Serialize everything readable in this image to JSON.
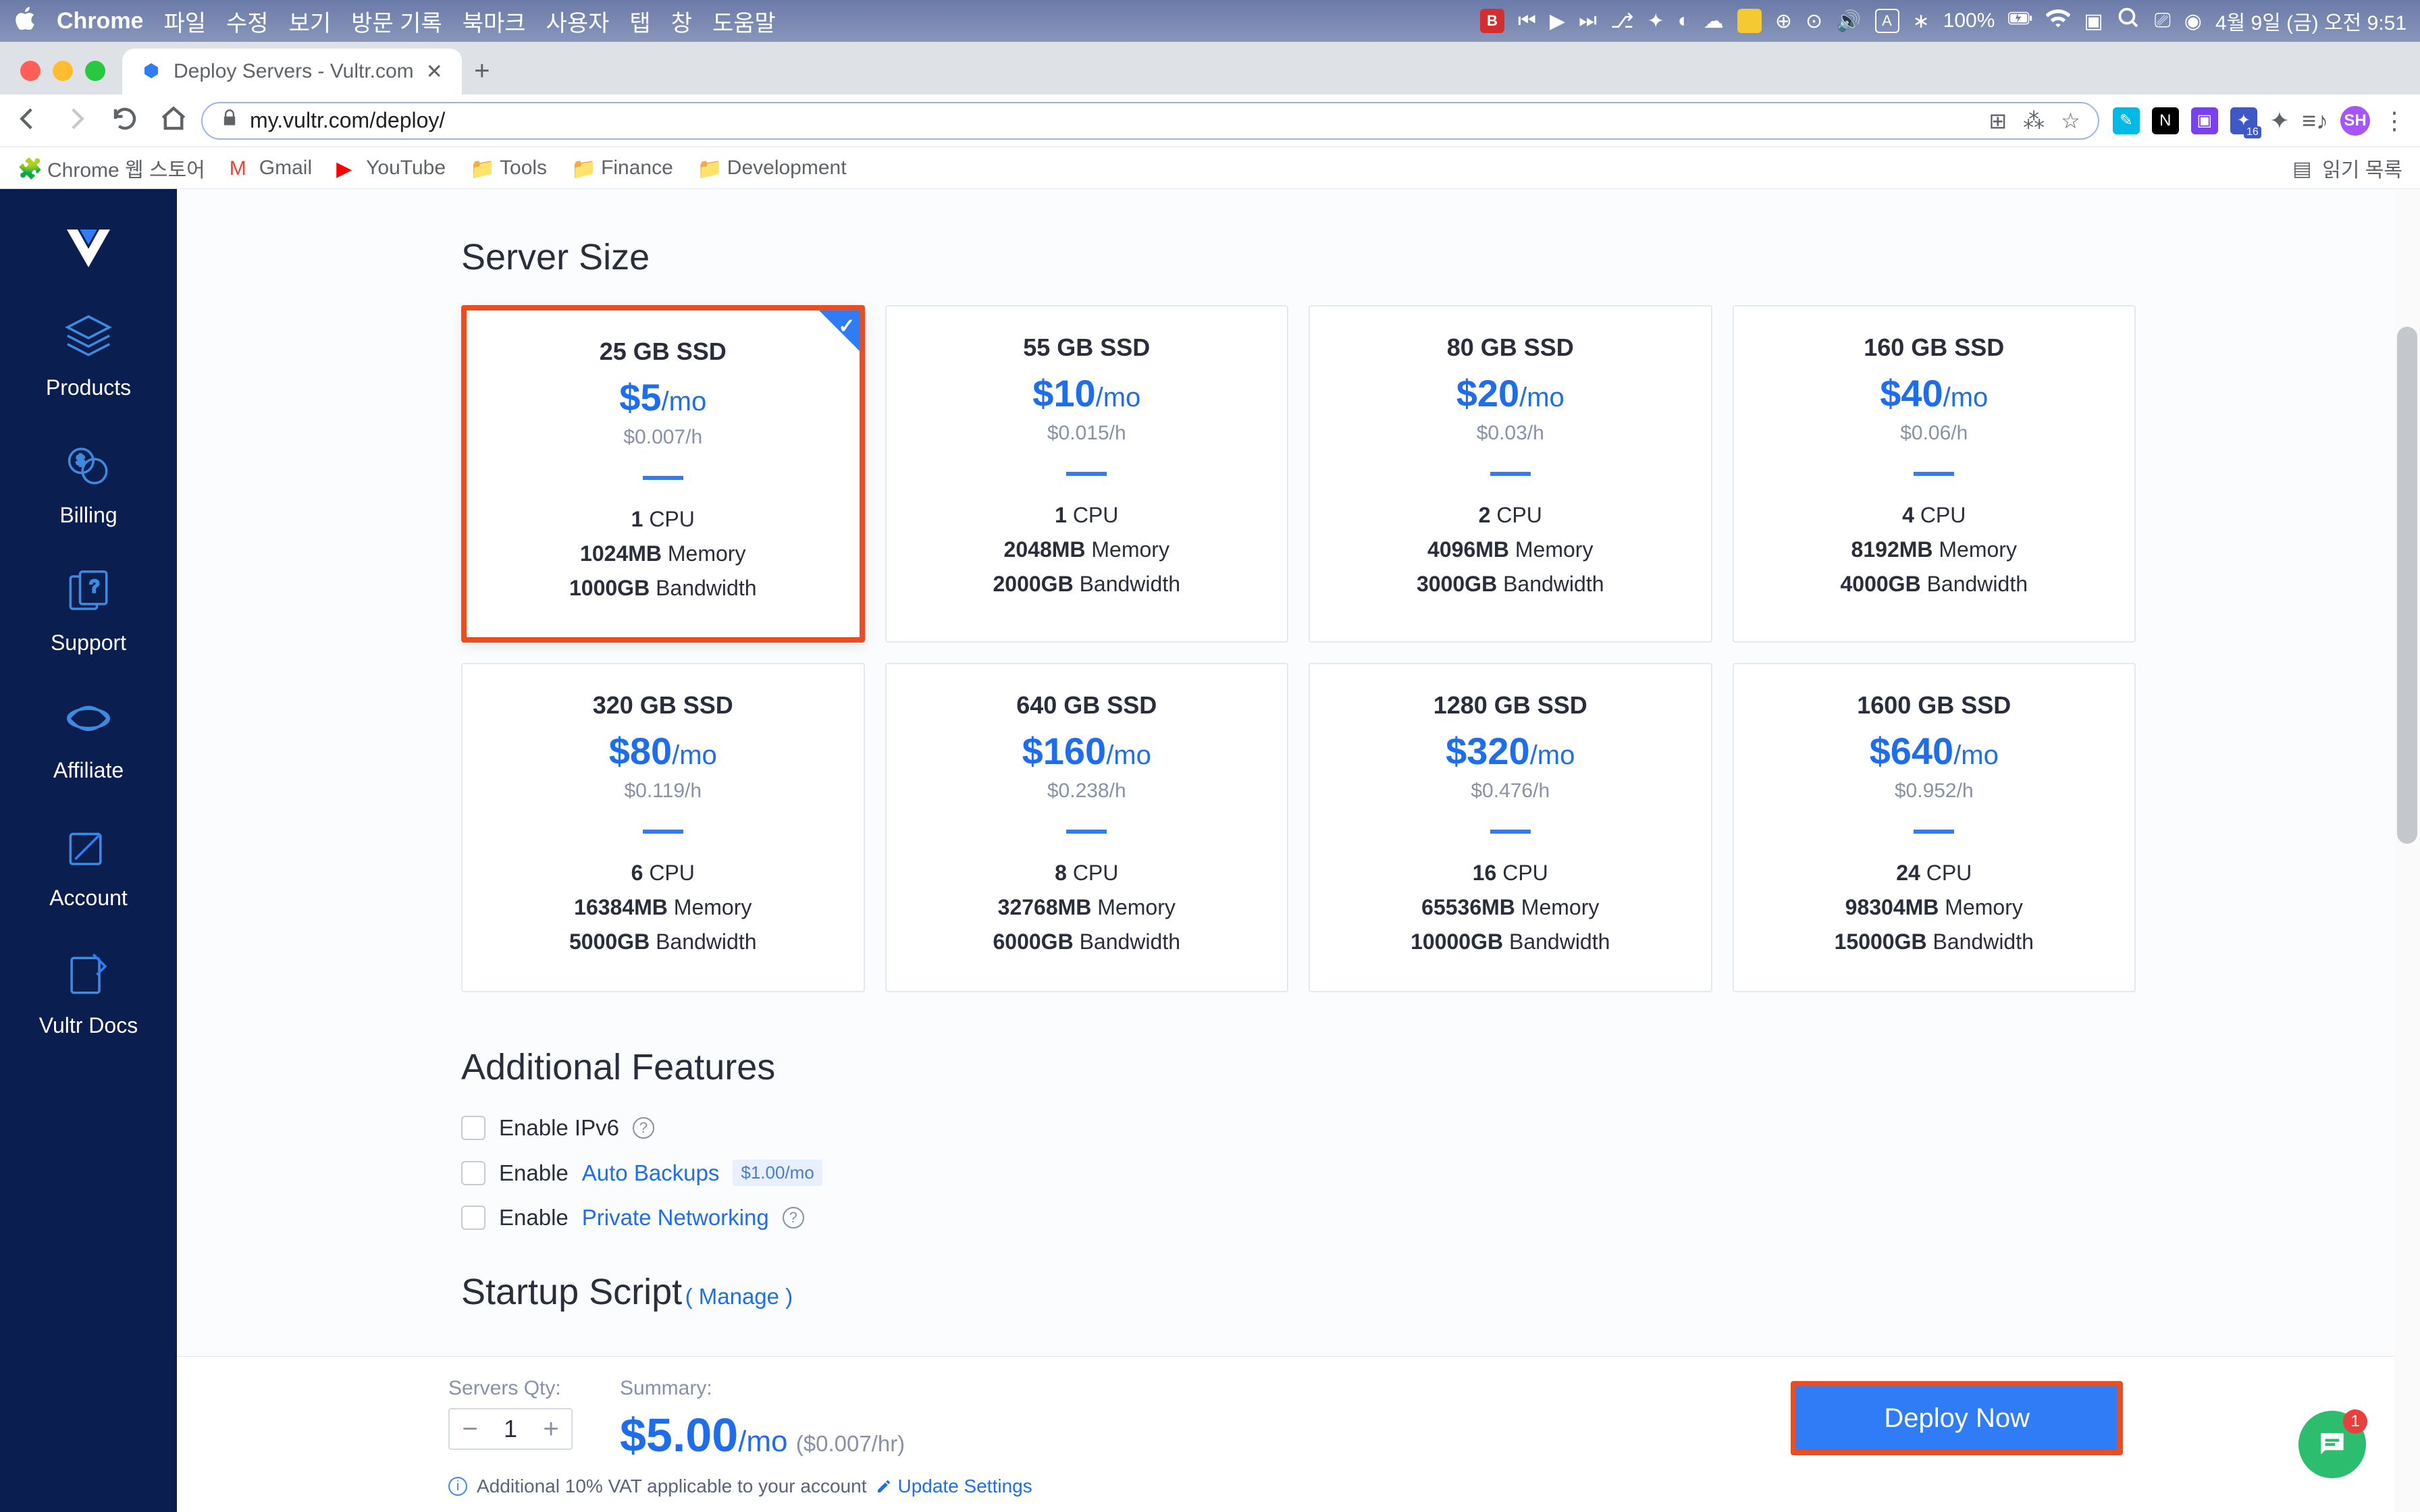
{
  "menubar": {
    "app": "Chrome",
    "items": [
      "파일",
      "수정",
      "보기",
      "방문 기록",
      "북마크",
      "사용자",
      "탭",
      "창",
      "도움말"
    ],
    "battery": "100%",
    "date": "4월 9일 (금) 오전 9:51"
  },
  "tab": {
    "title": "Deploy Servers - Vultr.com"
  },
  "url": "my.vultr.com/deploy/",
  "bookmarks": [
    "Chrome 웹 스토어",
    "Gmail",
    "YouTube",
    "Tools",
    "Finance",
    "Development"
  ],
  "reading_list": "읽기 목록",
  "sidebar": {
    "items": [
      {
        "label": "Products"
      },
      {
        "label": "Billing"
      },
      {
        "label": "Support"
      },
      {
        "label": "Affiliate"
      },
      {
        "label": "Account"
      },
      {
        "label": "Vultr Docs"
      }
    ]
  },
  "section_title": "Server Size",
  "plans": [
    {
      "ssd": "25 GB SSD",
      "price": "$5",
      "per": "/mo",
      "hourly": "$0.007/h",
      "cpu_n": "1",
      "cpu": " CPU",
      "mem_n": "1024MB",
      "mem": " Memory",
      "bw_n": "1000GB",
      "bw": " Bandwidth",
      "sel": true
    },
    {
      "ssd": "55 GB SSD",
      "price": "$10",
      "per": "/mo",
      "hourly": "$0.015/h",
      "cpu_n": "1",
      "cpu": " CPU",
      "mem_n": "2048MB",
      "mem": " Memory",
      "bw_n": "2000GB",
      "bw": " Bandwidth"
    },
    {
      "ssd": "80 GB SSD",
      "price": "$20",
      "per": "/mo",
      "hourly": "$0.03/h",
      "cpu_n": "2",
      "cpu": " CPU",
      "mem_n": "4096MB",
      "mem": " Memory",
      "bw_n": "3000GB",
      "bw": " Bandwidth"
    },
    {
      "ssd": "160 GB SSD",
      "price": "$40",
      "per": "/mo",
      "hourly": "$0.06/h",
      "cpu_n": "4",
      "cpu": " CPU",
      "mem_n": "8192MB",
      "mem": " Memory",
      "bw_n": "4000GB",
      "bw": " Bandwidth"
    },
    {
      "ssd": "320 GB SSD",
      "price": "$80",
      "per": "/mo",
      "hourly": "$0.119/h",
      "cpu_n": "6",
      "cpu": " CPU",
      "mem_n": "16384MB",
      "mem": " Memory",
      "bw_n": "5000GB",
      "bw": " Bandwidth"
    },
    {
      "ssd": "640 GB SSD",
      "price": "$160",
      "per": "/mo",
      "hourly": "$0.238/h",
      "cpu_n": "8",
      "cpu": " CPU",
      "mem_n": "32768MB",
      "mem": " Memory",
      "bw_n": "6000GB",
      "bw": " Bandwidth"
    },
    {
      "ssd": "1280 GB SSD",
      "price": "$320",
      "per": "/mo",
      "hourly": "$0.476/h",
      "cpu_n": "16",
      "cpu": " CPU",
      "mem_n": "65536MB",
      "mem": " Memory",
      "bw_n": "10000GB",
      "bw": " Bandwidth"
    },
    {
      "ssd": "1600 GB SSD",
      "price": "$640",
      "per": "/mo",
      "hourly": "$0.952/h",
      "cpu_n": "24",
      "cpu": " CPU",
      "mem_n": "98304MB",
      "mem": " Memory",
      "bw_n": "15000GB",
      "bw": " Bandwidth"
    }
  ],
  "features": {
    "title": "Additional Features",
    "ipv6_prefix": "Enable IPv6",
    "backups_prefix": "Enable ",
    "backups_link": "Auto Backups",
    "backups_badge": "$1.00/mo",
    "privnet_prefix": "Enable ",
    "privnet_link": "Private Networking"
  },
  "startup": {
    "title": "Startup Script",
    "manage": "( Manage )"
  },
  "footer": {
    "qty_label": "Servers Qty:",
    "qty_value": "1",
    "summary_label": "Summary:",
    "summary_price": "$5.00",
    "summary_per": "/mo ",
    "summary_hr": "($0.007/hr)",
    "deploy": "Deploy Now",
    "vat": "Additional 10% VAT applicable to your account",
    "update": "Update Settings"
  },
  "chat": {
    "badge": "1"
  },
  "avatar": "SH"
}
